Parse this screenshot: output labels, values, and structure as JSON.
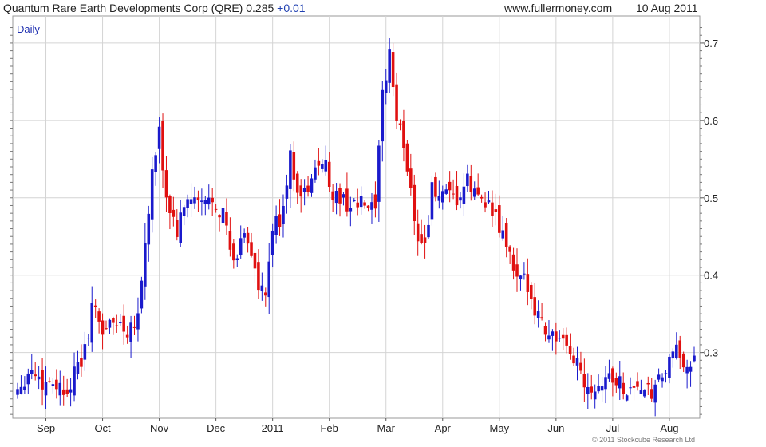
{
  "header": {
    "title": "Quantum Rare Earth Developments Corp (QRE)",
    "price": "0.285",
    "change": "+0.01",
    "website": "www.fullermoney.com",
    "date": "10 Aug 2011"
  },
  "chart_data": {
    "type": "ohlc",
    "title": "Quantum Rare Earth Developments Corp (QRE)",
    "period_label": "Daily",
    "copyright": "© 2011 Stockcube Research Ltd",
    "y_axis_side": "right",
    "ylim": [
      0.215,
      0.735
    ],
    "y_ticks": [
      0.3,
      0.4,
      0.5,
      0.6,
      0.7
    ],
    "y_tick_labels": [
      "0.3",
      "0.4",
      "0.5",
      "0.6",
      "0.7"
    ],
    "x_tick_labels": [
      "Sep",
      "Oct",
      "Nov",
      "Dec",
      "2011",
      "Feb",
      "Mar",
      "Apr",
      "May",
      "Jun",
      "Jul",
      "Aug"
    ],
    "x_tick_positions": [
      8,
      24,
      40,
      56,
      72,
      88,
      104,
      120,
      136,
      152,
      168,
      184
    ],
    "n_bars": 192,
    "grid": true,
    "up_color": "#1a1acc",
    "down_color": "#e01010",
    "anchor_closes": [
      [
        0,
        0.255
      ],
      [
        4,
        0.28
      ],
      [
        7,
        0.26
      ],
      [
        10,
        0.265
      ],
      [
        13,
        0.25
      ],
      [
        16,
        0.27
      ],
      [
        19,
        0.3
      ],
      [
        21,
        0.36
      ],
      [
        24,
        0.33
      ],
      [
        28,
        0.34
      ],
      [
        31,
        0.33
      ],
      [
        34,
        0.35
      ],
      [
        36,
        0.44
      ],
      [
        38,
        0.53
      ],
      [
        40,
        0.58
      ],
      [
        42,
        0.5
      ],
      [
        45,
        0.455
      ],
      [
        48,
        0.5
      ],
      [
        52,
        0.49
      ],
      [
        55,
        0.5
      ],
      [
        58,
        0.48
      ],
      [
        61,
        0.41
      ],
      [
        64,
        0.46
      ],
      [
        66,
        0.43
      ],
      [
        68,
        0.38
      ],
      [
        70,
        0.37
      ],
      [
        72,
        0.46
      ],
      [
        74,
        0.47
      ],
      [
        77,
        0.55
      ],
      [
        80,
        0.5
      ],
      [
        83,
        0.52
      ],
      [
        86,
        0.555
      ],
      [
        89,
        0.505
      ],
      [
        92,
        0.495
      ],
      [
        95,
        0.49
      ],
      [
        98,
        0.49
      ],
      [
        101,
        0.48
      ],
      [
        103,
        0.63
      ],
      [
        105,
        0.69
      ],
      [
        107,
        0.6
      ],
      [
        109,
        0.57
      ],
      [
        111,
        0.51
      ],
      [
        113,
        0.45
      ],
      [
        115,
        0.44
      ],
      [
        117,
        0.51
      ],
      [
        120,
        0.5
      ],
      [
        124,
        0.495
      ],
      [
        127,
        0.52
      ],
      [
        129,
        0.505
      ],
      [
        132,
        0.5
      ],
      [
        135,
        0.47
      ],
      [
        138,
        0.44
      ],
      [
        141,
        0.39
      ],
      [
        144,
        0.39
      ],
      [
        146,
        0.36
      ],
      [
        149,
        0.33
      ],
      [
        152,
        0.32
      ],
      [
        155,
        0.3
      ],
      [
        158,
        0.29
      ],
      [
        160,
        0.265
      ],
      [
        163,
        0.255
      ],
      [
        166,
        0.27
      ],
      [
        169,
        0.265
      ],
      [
        172,
        0.25
      ],
      [
        175,
        0.26
      ],
      [
        177,
        0.245
      ],
      [
        180,
        0.25
      ],
      [
        182,
        0.27
      ],
      [
        184,
        0.285
      ],
      [
        186,
        0.3
      ],
      [
        188,
        0.29
      ],
      [
        191,
        0.285
      ]
    ]
  }
}
